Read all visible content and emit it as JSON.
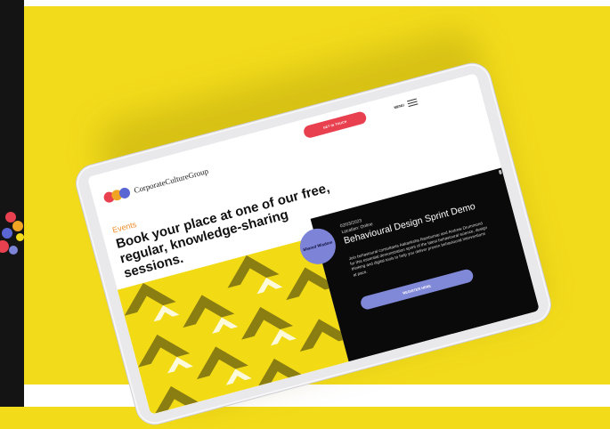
{
  "colors": {
    "background": "#f2db1a",
    "accent_red": "#e8404f",
    "accent_orange": "#f08c28",
    "accent_purple": "#7d84d8",
    "logo_circles": [
      "#e8404f",
      "#f0a424",
      "#5a66d4"
    ]
  },
  "header": {
    "brand": "CorporateCultureGroup",
    "cta_label": "GET IN TOUCH",
    "menu_label": "MENU"
  },
  "hero": {
    "eyebrow": "Events",
    "headline": "Book your place at one of our free, regular, knowledge-sharing sessions."
  },
  "event": {
    "badge": "Shared Wisdom",
    "date": "02/03/2023",
    "location": "Location: Online",
    "title": "Behavioural Design Sprint Demo",
    "description": "Join behavioural consultants Aakanksha Rambumar and Andrew Drummond for this essential demonstration sprint of the latest behavioural science, design thinking and digital tools to help you deliver proven behavioural interventions at pace.",
    "button_label": "REGISTER HERE"
  },
  "icons": {
    "logo": "brand-circles-icon",
    "menu": "hamburger-menu-icon",
    "pattern": "chevron-pattern"
  }
}
